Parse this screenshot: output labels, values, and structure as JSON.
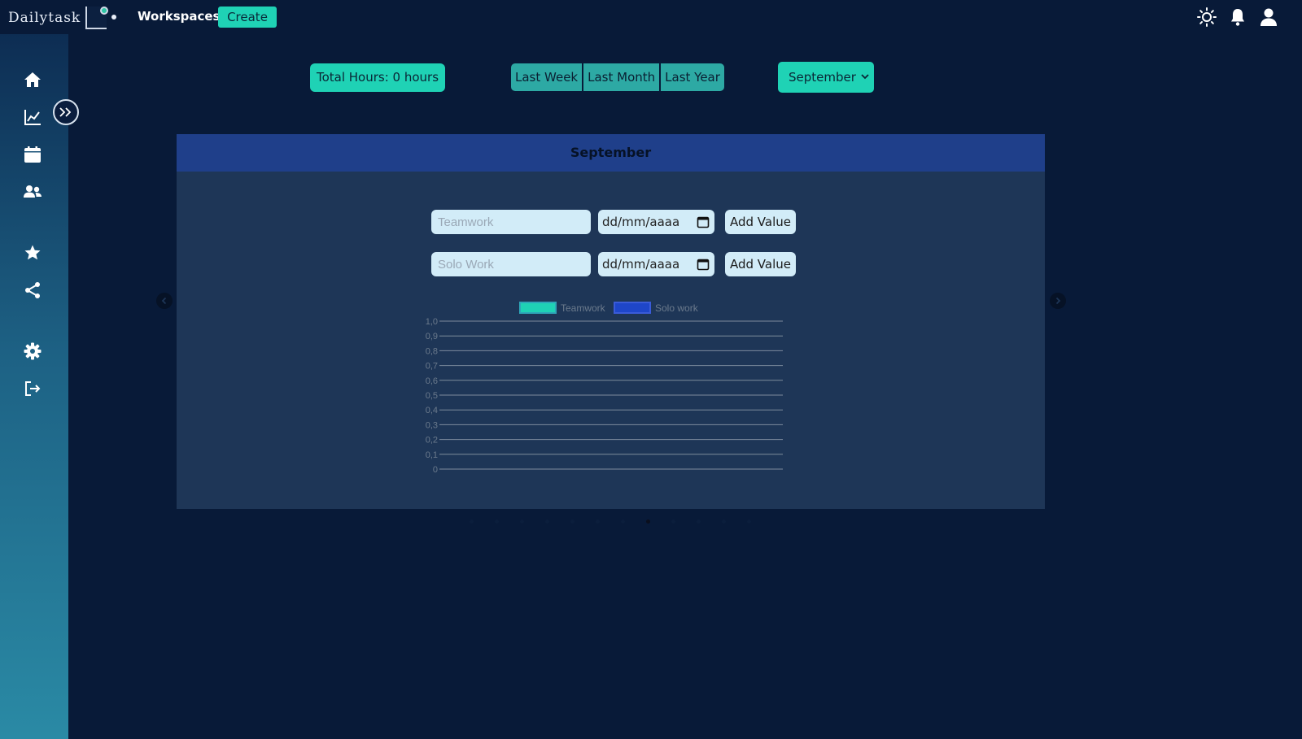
{
  "app": {
    "logo_text": "Dailytask",
    "nav_workspaces": "Workspaces",
    "create_label": "Create"
  },
  "topbar_icons": [
    "sun-icon",
    "bell-icon",
    "user-icon"
  ],
  "sidebar": {
    "items": [
      "home-icon",
      "chart-line-icon",
      "calendar-icon",
      "users-icon",
      "star-icon",
      "share-icon",
      "gear-icon",
      "logout-icon"
    ]
  },
  "controls": {
    "total_hours": "Total Hours: 0 hours",
    "ranges": [
      "Last Week",
      "Last Month",
      "Last Year"
    ],
    "month_selected": "September"
  },
  "carousel": {
    "title": "September",
    "rows": [
      {
        "placeholder": "Teamwork",
        "date": "dd/mm/aaaa",
        "button": "Add Value"
      },
      {
        "placeholder": "Solo Work",
        "date": "dd/mm/aaaa",
        "button": "Add Value"
      }
    ],
    "slides_count": 12,
    "active_slide": 8
  },
  "colors": {
    "accent": "#1fd2b5",
    "background": "#081a38",
    "panel": "#1e3657",
    "panel_header": "#1f3f8a",
    "teamwork_series": "#1fd2b5",
    "solo_series": "#1e46c9"
  },
  "chart_data": {
    "type": "bar",
    "legend": [
      "Teamwork",
      "Solo work"
    ],
    "series": [
      {
        "name": "Teamwork",
        "values": []
      },
      {
        "name": "Solo work",
        "values": []
      }
    ],
    "ylim": [
      0,
      1
    ],
    "yticks": [
      "0",
      "0,1",
      "0,2",
      "0,3",
      "0,4",
      "0,5",
      "0,6",
      "0,7",
      "0,8",
      "0,9",
      "1,0"
    ],
    "grid": true,
    "legend_position": "top"
  }
}
